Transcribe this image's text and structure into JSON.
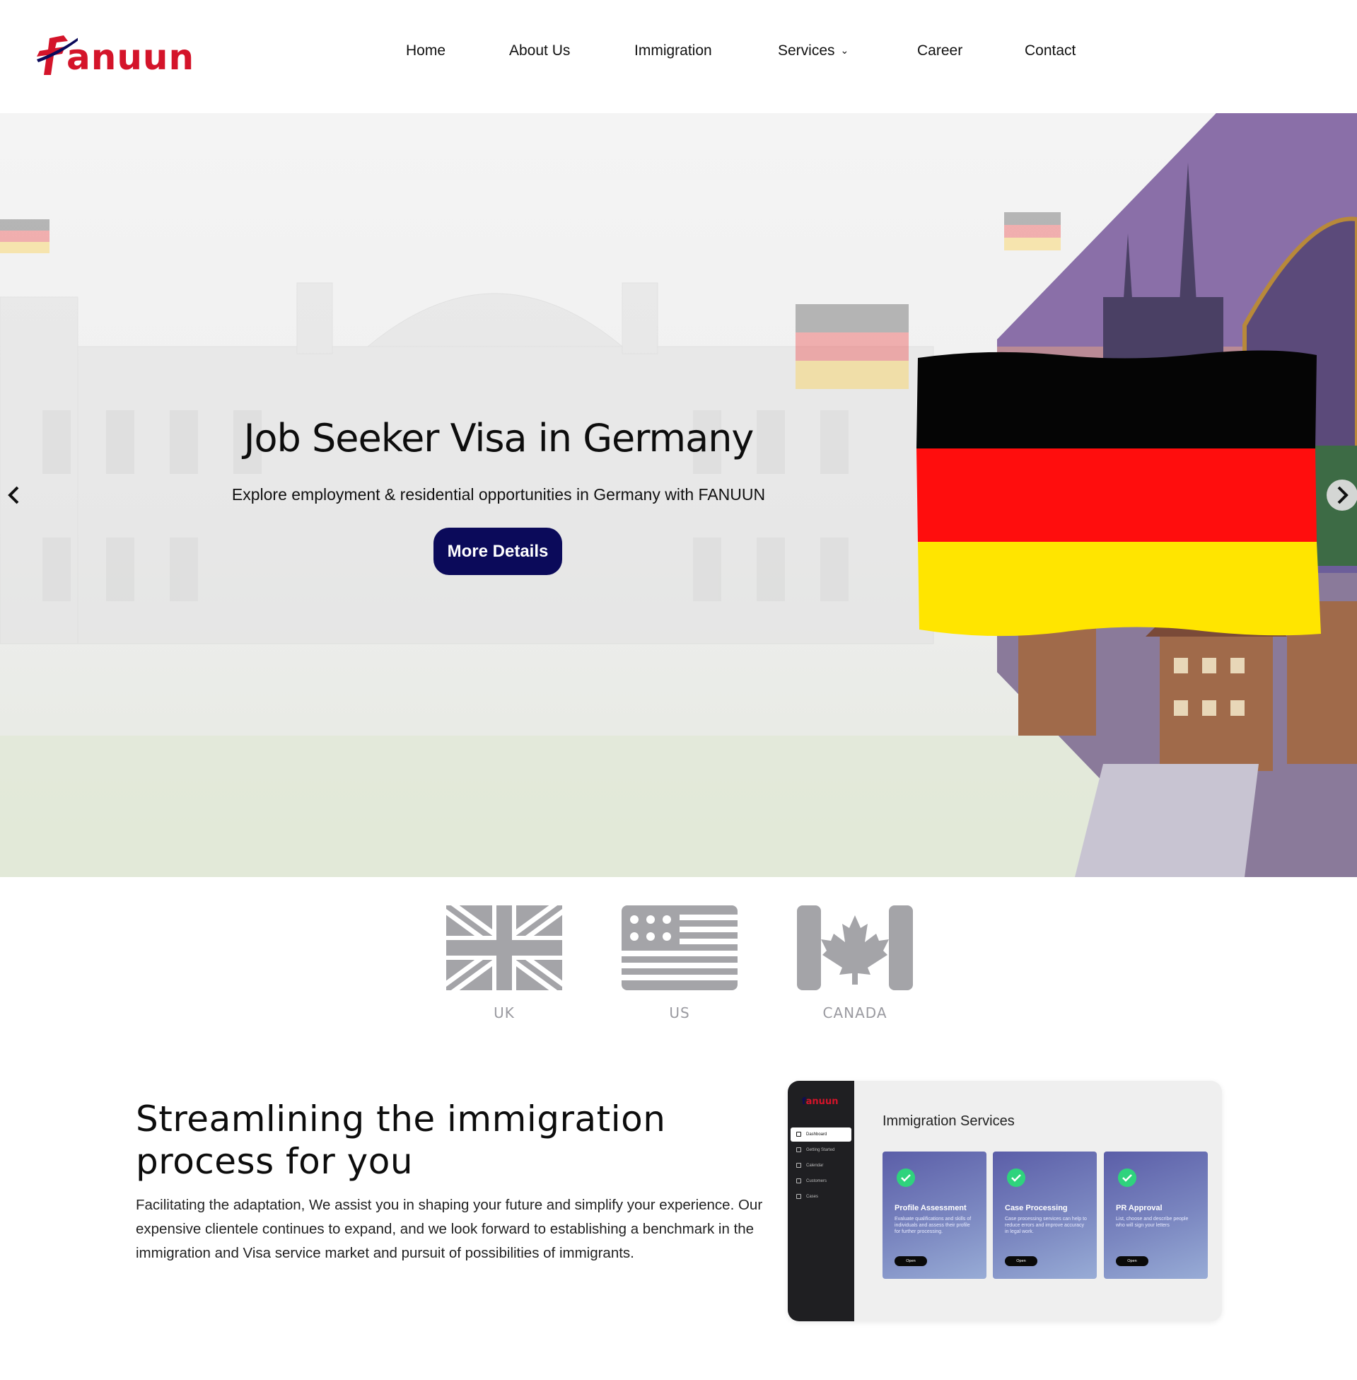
{
  "brand": {
    "name": "Fanuun",
    "logo_text": "anuun",
    "primary_color": "#d4142a",
    "accent_color": "#0b0a5a"
  },
  "nav": {
    "items": [
      {
        "label": "Home"
      },
      {
        "label": "About Us"
      },
      {
        "label": "Immigration"
      },
      {
        "label": "Services",
        "has_dropdown": true
      },
      {
        "label": "Career"
      },
      {
        "label": "Contact"
      }
    ]
  },
  "hero": {
    "title": "Job Seeker Visa in Germany",
    "subtitle": "Explore employment & residential opportunities in Germany with FANUUN",
    "button_label": "More Details",
    "prev_icon": "chevron-left-icon",
    "next_icon": "chevron-right-icon",
    "flag_colors": [
      "#000000",
      "#ff0000",
      "#ffd700"
    ]
  },
  "countries": [
    {
      "label": "UK",
      "icon": "uk-flag-icon"
    },
    {
      "label": "US",
      "icon": "us-flag-icon"
    },
    {
      "label": "CANADA",
      "icon": "canada-flag-icon"
    }
  ],
  "about": {
    "title_line1": "Streamlining the immigration",
    "title_line2": "process for you",
    "text": "Facilitating the adaptation, We assist you in shaping your future and simplify your experience. Our expensive clientele continues to expand, and we look forward to establishing a benchmark in the immigration and Visa service market and pursuit of possibilities of immigrants."
  },
  "dashboard_mock": {
    "logo_text": "anuun",
    "sidebar": [
      {
        "label": "Dashboard",
        "active": true
      },
      {
        "label": "Getting Started"
      },
      {
        "label": "Calendar"
      },
      {
        "label": "Customers"
      },
      {
        "label": "Cases"
      }
    ],
    "heading": "Immigration Services",
    "cards": [
      {
        "title": "Profile Assessment",
        "desc": "Evaluate qualifications and skills of individuals and assess their profile for further processing.",
        "button": "Open"
      },
      {
        "title": "Case Processing",
        "desc": "Case processing services can help to reduce errors and improve accuracy in legal work.",
        "button": "Open"
      },
      {
        "title": "PR Approval",
        "desc": "List, choose and describe people who will sign your letters",
        "button": "Open"
      }
    ]
  }
}
